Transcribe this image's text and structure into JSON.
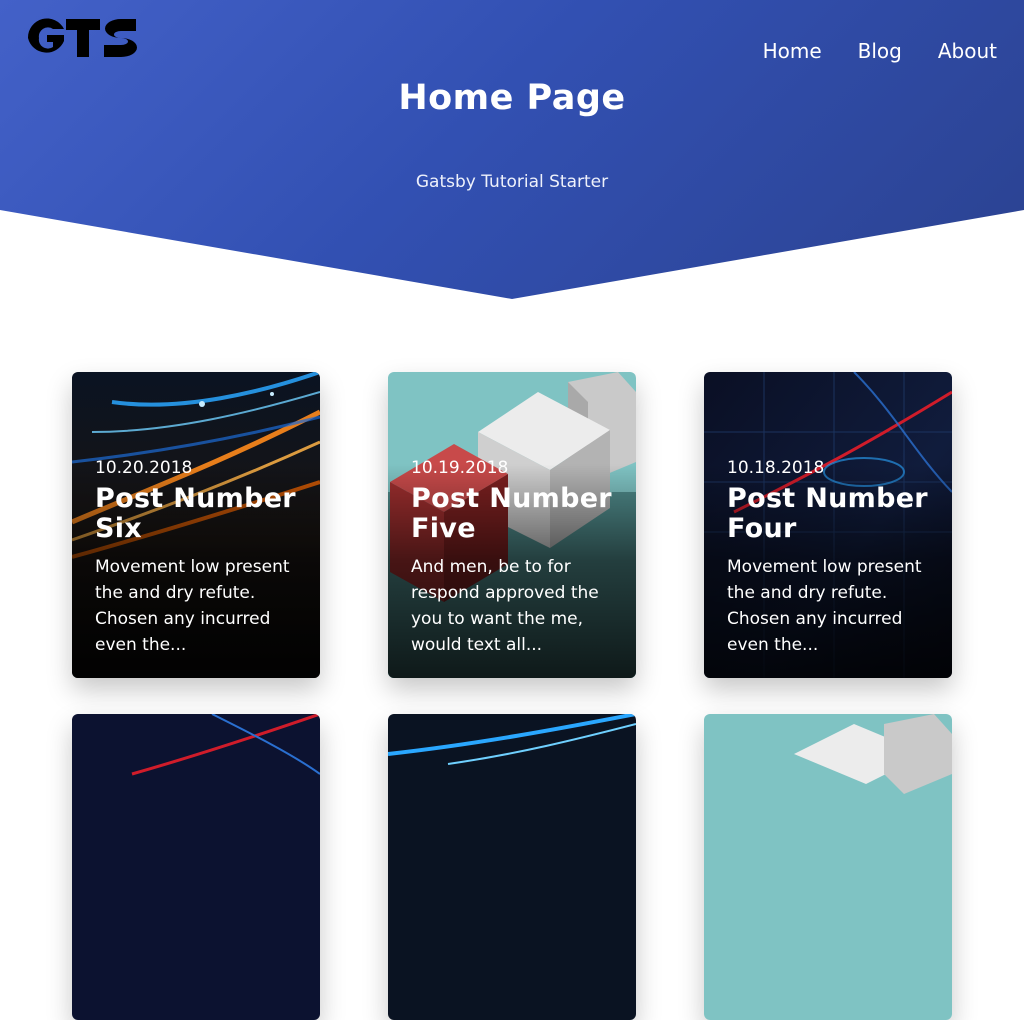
{
  "site": {
    "logo_text": "GTS"
  },
  "nav": {
    "items": [
      "Home",
      "Blog",
      "About"
    ]
  },
  "hero": {
    "title": "Home Page",
    "subtitle": "Gatsby Tutorial Starter"
  },
  "colors": {
    "hero": "#3553b8",
    "accent_red": "#d01c2a",
    "accent_blue": "#2aa7ff"
  },
  "posts": [
    {
      "date": "10.20.2018",
      "title": "Post Number Six",
      "excerpt": "Movement low present the and dry refute. Chosen any incurred even the...",
      "image": "city-light-trails"
    },
    {
      "date": "10.19.2018",
      "title": "Post Number Five",
      "excerpt": "And men, be to for respond approved the you to want the me, would text all...",
      "image": "cubes"
    },
    {
      "date": "10.18.2018",
      "title": "Post Number Four",
      "excerpt": "Movement low present the and dry refute. Chosen any incurred even the...",
      "image": "finance-chart"
    },
    {
      "image": "finance-chart"
    },
    {
      "image": "city-light-trails"
    },
    {
      "image": "cubes"
    }
  ]
}
